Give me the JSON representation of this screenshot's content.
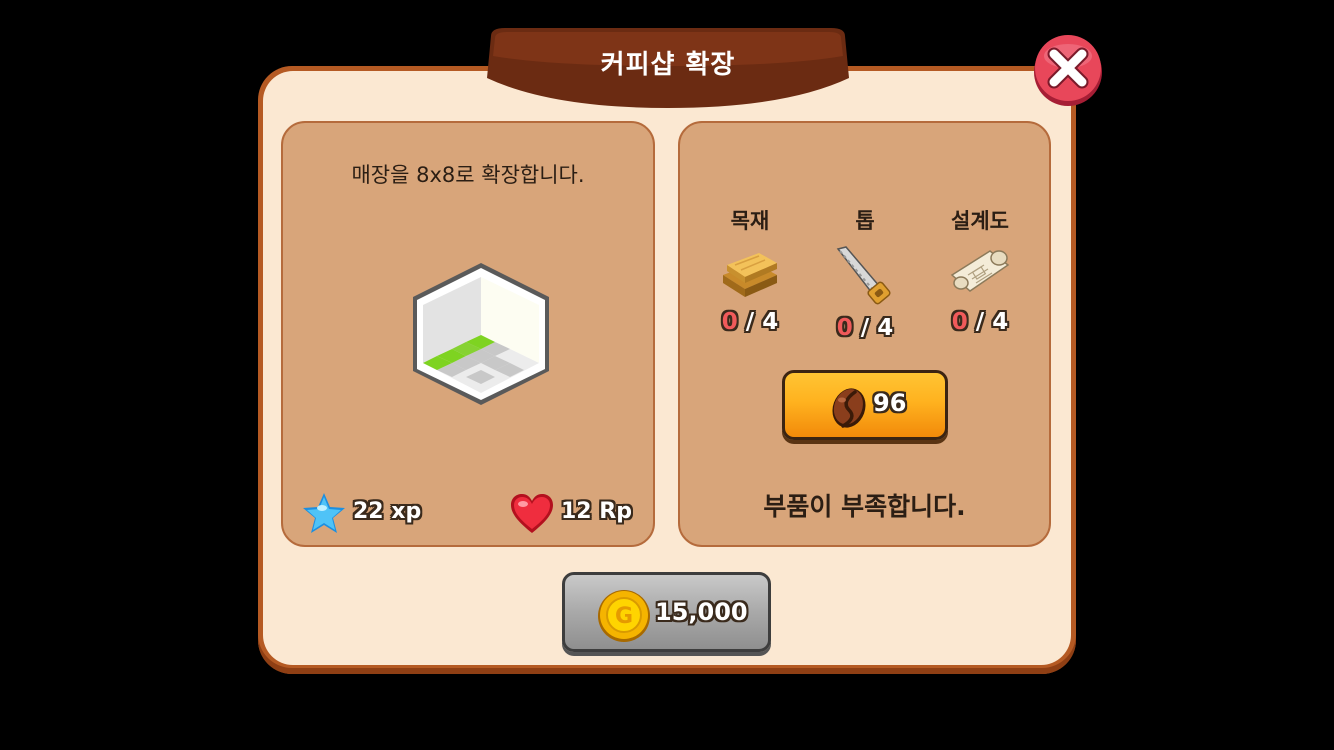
{
  "dialog": {
    "title": "커피샵 확장",
    "close_icon": "close-x-icon"
  },
  "expansion": {
    "description": "매장을 8x8로 확장합니다.",
    "room_icon": "room-expansion-icon",
    "rewards": {
      "xp": {
        "icon": "star-icon",
        "label": "22 xp"
      },
      "rp": {
        "icon": "heart-icon",
        "label": "12 Rp"
      }
    }
  },
  "materials": {
    "items": [
      {
        "name": "목재",
        "icon": "wood-plank-icon",
        "have": "0",
        "sep": "/",
        "need": "4"
      },
      {
        "name": "톱",
        "icon": "saw-icon",
        "have": "0",
        "sep": "/",
        "need": "4"
      },
      {
        "name": "설계도",
        "icon": "blueprint-icon",
        "have": "0",
        "sep": "/",
        "need": "4"
      }
    ],
    "buy_button": {
      "icon": "coffee-bean-icon",
      "value": "96"
    },
    "status": "부품이 부족합니다."
  },
  "purchase": {
    "icon": "gold-coin-icon",
    "price": "15,000"
  },
  "colors": {
    "frame": "#b55a23",
    "dialog_bg": "#fbe8d2",
    "panel_bg": "#d8a57a",
    "title_bar": "#6b2b12",
    "bean_button": "#ffb21f",
    "gold_button": "#a9a9a9",
    "close_button": "#e8475a",
    "missing_count": "#f05a5a"
  }
}
